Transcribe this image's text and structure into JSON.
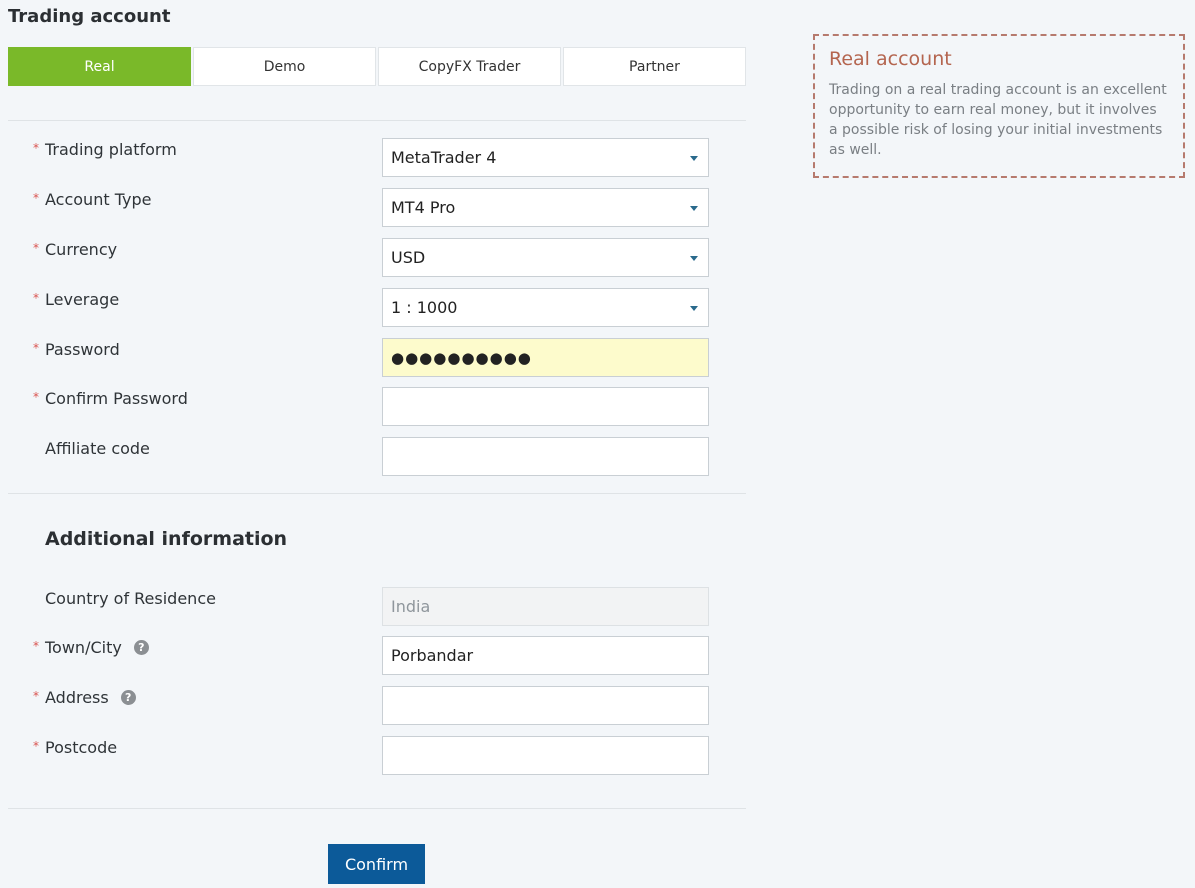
{
  "title": "Trading account",
  "tabs": [
    {
      "label": "Real",
      "active": true
    },
    {
      "label": "Demo",
      "active": false
    },
    {
      "label": "CopyFX Trader",
      "active": false
    },
    {
      "label": "Partner",
      "active": false
    }
  ],
  "form": {
    "trading_platform": {
      "label": "Trading platform",
      "value": "MetaTrader 4"
    },
    "account_type": {
      "label": "Account Type",
      "value": "MT4 Pro"
    },
    "currency": {
      "label": "Currency",
      "value": "USD"
    },
    "leverage": {
      "label": "Leverage",
      "value": "1 : 1000"
    },
    "password": {
      "label": "Password",
      "value": "●●●●●●●●●●"
    },
    "confirm_password": {
      "label": "Confirm Password",
      "value": ""
    },
    "affiliate_code": {
      "label": "Affiliate code",
      "value": ""
    }
  },
  "additional": {
    "title": "Additional information",
    "country": {
      "label": "Country of Residence",
      "value": "India"
    },
    "town": {
      "label": "Town/City",
      "value": "Porbandar"
    },
    "address": {
      "label": "Address",
      "value": ""
    },
    "postcode": {
      "label": "Postcode",
      "value": ""
    }
  },
  "required_mark": "*",
  "help_glyph": "?",
  "confirm_label": "Confirm",
  "info": {
    "title": "Real account",
    "text": "Trading on a real trading account is an excellent opportunity to earn real money, but it involves a possible risk of losing your initial investments as well."
  },
  "colors": {
    "accent_green": "#7ab929",
    "button_blue": "#0c5a99",
    "info_title": "#b4654f"
  }
}
